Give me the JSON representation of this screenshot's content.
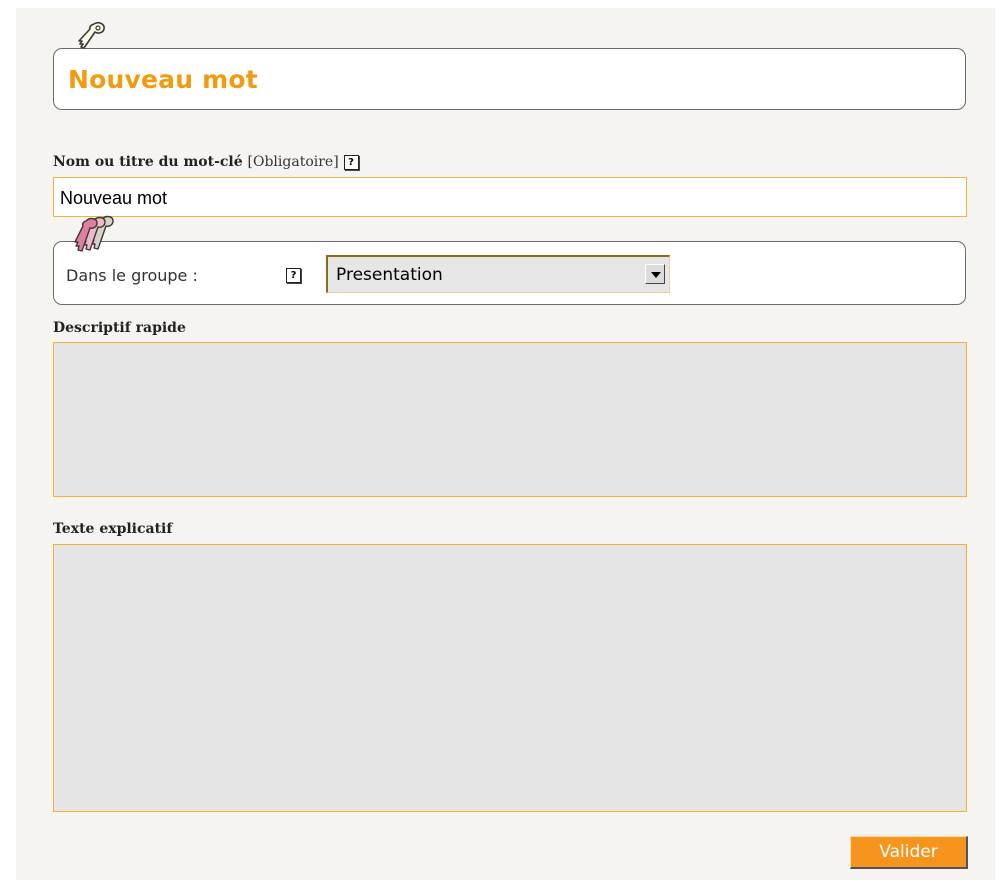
{
  "header": {
    "title": "Nouveau mot",
    "icon": "keyword-icon"
  },
  "name_field": {
    "label": "Nom ou titre du mot-clé",
    "required_note": "[Obligatoire]",
    "help": "?",
    "value": "Nouveau mot"
  },
  "group": {
    "icon": "keywords-group-icon",
    "label": "Dans le groupe :",
    "help": "?",
    "selected": "Presentation"
  },
  "description": {
    "label": "Descriptif rapide",
    "value": ""
  },
  "explanatory_text": {
    "label": "Texte explicatif",
    "value": ""
  },
  "submit": {
    "label": "Valider"
  },
  "colors": {
    "accent": "#f29b11",
    "button": "#f7941d",
    "field_border": "#f0b43a",
    "panel_bg": "#f5f4f0",
    "textarea_bg": "#e5e5e5"
  }
}
